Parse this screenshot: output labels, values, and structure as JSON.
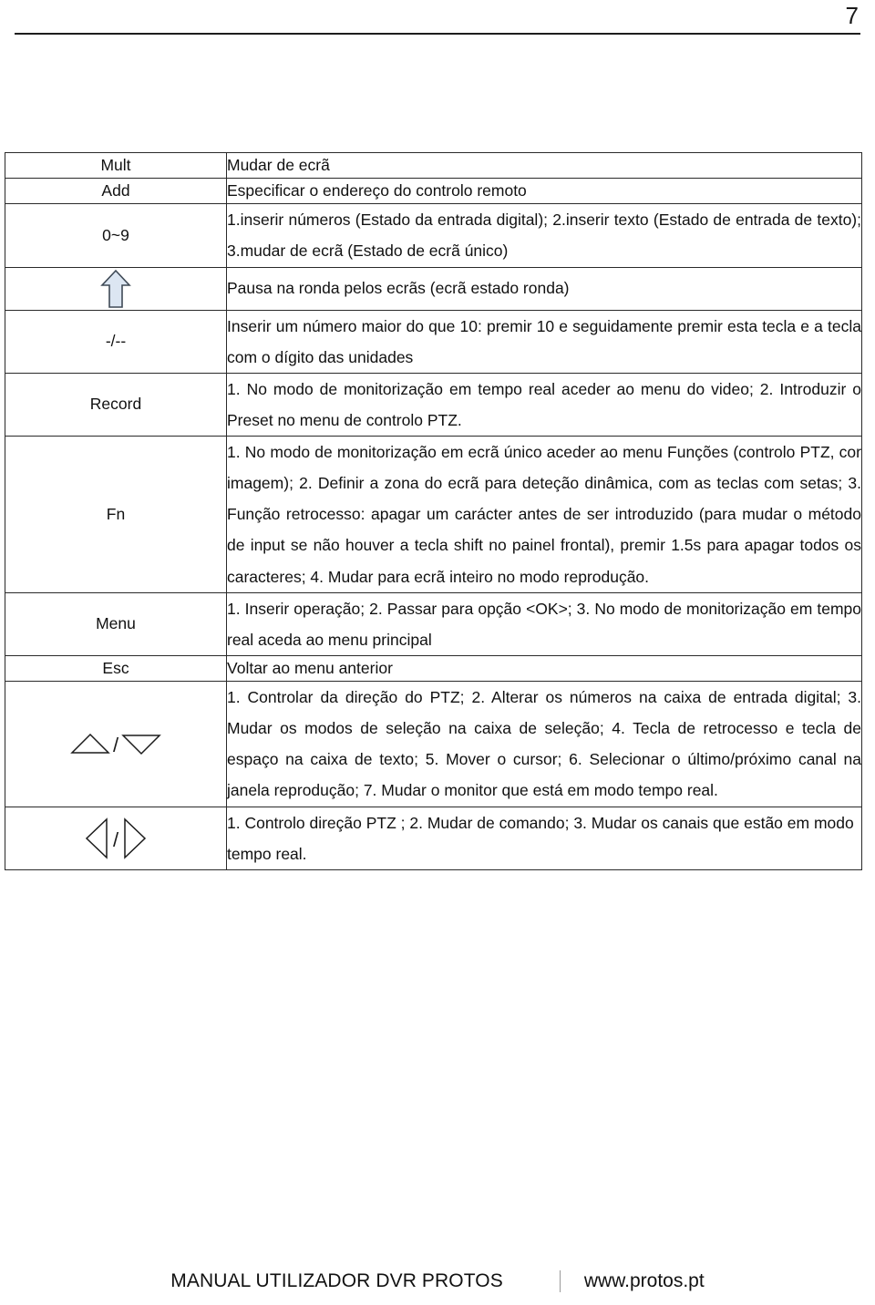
{
  "header": {
    "page_number": "7"
  },
  "table": {
    "rows": [
      {
        "key_type": "text",
        "key": "Mult",
        "key_icon": "",
        "desc": "Mudar de ecrã",
        "single_line": true,
        "justify": false
      },
      {
        "key_type": "text",
        "key": "Add",
        "key_icon": "",
        "desc": "Especificar o endereço do controlo remoto",
        "single_line": true,
        "justify": false
      },
      {
        "key_type": "text",
        "key": "0~9",
        "key_icon": "",
        "desc": "1.inserir números (Estado da entrada digital); 2.inserir texto (Estado de entrada de texto); 3.mudar de ecrã (Estado de ecrã único)",
        "single_line": false,
        "justify": true
      },
      {
        "key_type": "icon",
        "key": "",
        "key_icon": "up-arrow-filled-icon",
        "desc": "Pausa na ronda pelos ecrãs (ecrã estado ronda)",
        "single_line": true,
        "justify": false
      },
      {
        "key_type": "text",
        "key": "-/--",
        "key_icon": "",
        "desc": "Inserir um número maior do que 10: premir 10 e seguidamente premir esta tecla e a tecla com o dígito das unidades",
        "single_line": false,
        "justify": true
      },
      {
        "key_type": "text",
        "key": "Record",
        "key_icon": "",
        "desc": "1. No modo de monitorização em tempo real aceder ao menu do video; 2. Introduzir o Preset no menu de controlo PTZ.",
        "single_line": false,
        "justify": true
      },
      {
        "key_type": "text",
        "key": "Fn",
        "key_icon": "",
        "desc": "1. No modo de monitorização em ecrã único aceder ao menu Funções (controlo PTZ, cor imagem); 2. Definir a zona do ecrã para deteção dinâmica, com as teclas com setas; 3. Função retrocesso: apagar um carácter antes de ser introduzido (para mudar o método de input se não houver a tecla shift no painel frontal), premir 1.5s para apagar todos os caracteres; 4. Mudar para ecrã inteiro no modo reprodução.",
        "single_line": false,
        "justify": true
      },
      {
        "key_type": "text",
        "key": "Menu",
        "key_icon": "",
        "desc": "1. Inserir operação; 2. Passar para opção <OK>; 3. No modo de monitorização em tempo real aceda ao menu principal",
        "single_line": false,
        "justify": true
      },
      {
        "key_type": "text",
        "key": "Esc",
        "key_icon": "",
        "desc": "Voltar ao menu anterior",
        "single_line": true,
        "justify": false
      },
      {
        "key_type": "icon",
        "key": "",
        "key_icon": "up-down-triangles-icon",
        "desc": "1. Controlar da direção do PTZ; 2. Alterar os números na caixa de entrada digital; 3. Mudar os modos de seleção na caixa de seleção; 4. Tecla de retrocesso e tecla de espaço na caixa de texto; 5. Mover o cursor; 6. Selecionar o último/próximo canal na janela reprodução; 7. Mudar o monitor que está em modo tempo real.",
        "single_line": false,
        "justify": true
      },
      {
        "key_type": "icon",
        "key": "",
        "key_icon": "left-right-triangles-icon",
        "desc": "1. Controlo direção PTZ ; 2. Mudar de comando; 3. Mudar os canais que estão em modo tempo real.",
        "single_line": false,
        "justify": false
      }
    ]
  },
  "footer": {
    "title": "MANUAL UTILIZADOR DVR PROTOS",
    "separator": "|",
    "site": "www.protos.pt"
  },
  "colors": {
    "arrow_fill": "#dce6f2",
    "arrow_stroke": "#3f4a56",
    "rule": "#1d1d1d",
    "border": "#2a2a2a"
  }
}
